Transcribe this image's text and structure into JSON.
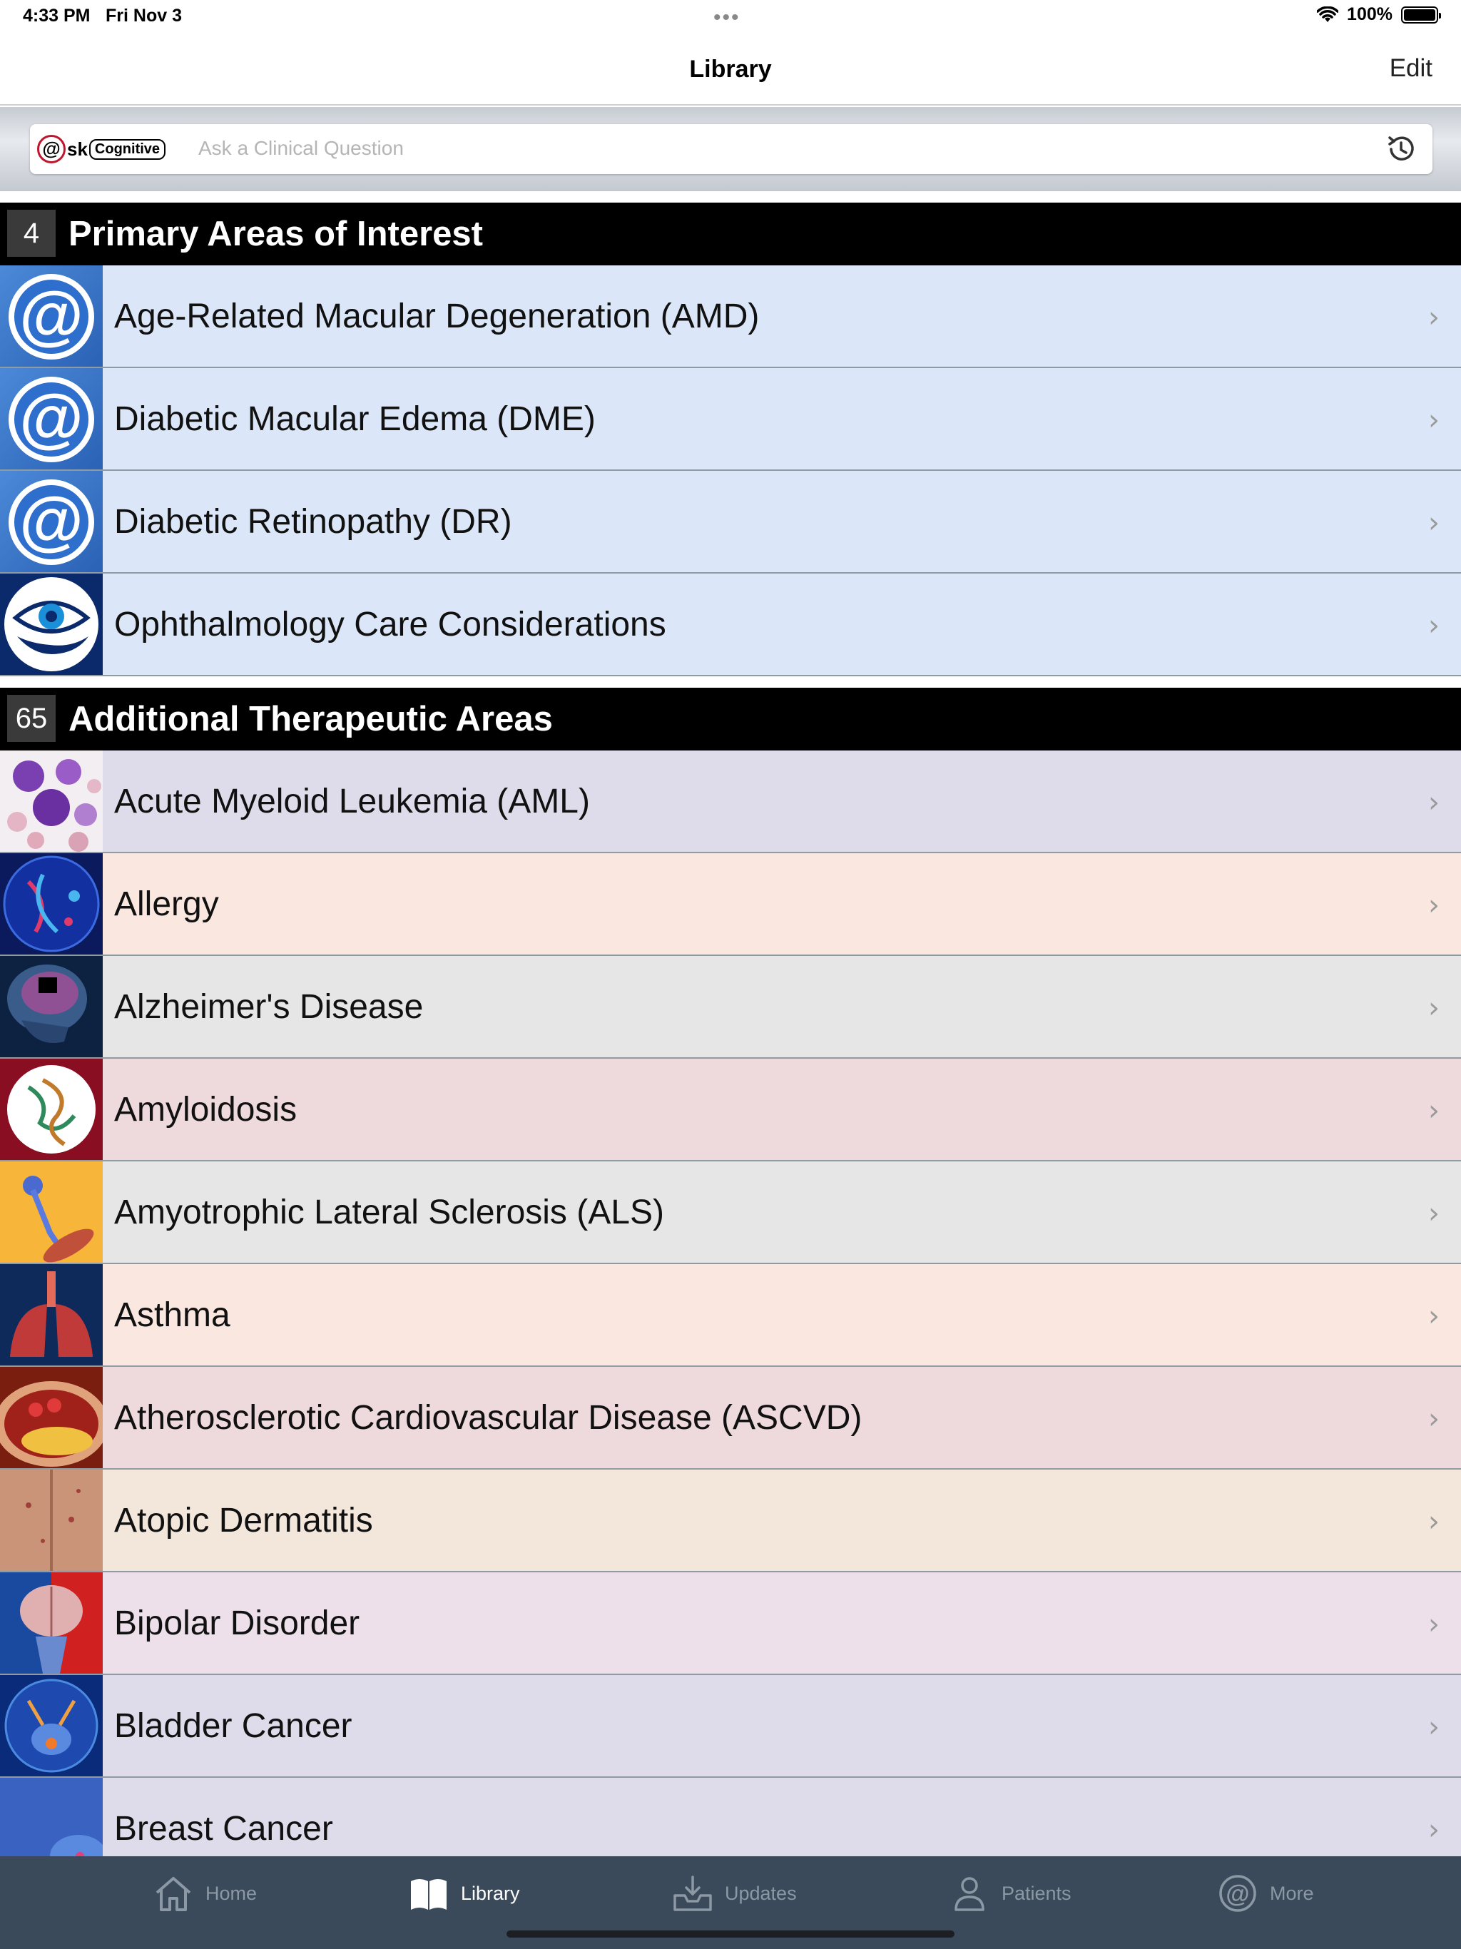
{
  "status_bar": {
    "time": "4:33 PM",
    "date": "Fri Nov 3",
    "battery": "100%"
  },
  "nav": {
    "title": "Library",
    "edit_label": "Edit"
  },
  "search": {
    "placeholder": "Ask a Clinical Question",
    "logo_at": "@",
    "logo_sk": "sk",
    "logo_cognitive": "Cognitive"
  },
  "sections": [
    {
      "count": "4",
      "title": "Primary Areas of Interest",
      "items": [
        {
          "label": "Age-Related Macular Degeneration (AMD)",
          "icon": "at-icon",
          "bg": "#dbe7f8"
        },
        {
          "label": "Diabetic Macular Edema (DME)",
          "icon": "at-icon",
          "bg": "#dbe7f8"
        },
        {
          "label": "Diabetic Retinopathy (DR)",
          "icon": "at-icon",
          "bg": "#dbe7f8"
        },
        {
          "label": "Ophthalmology Care Considerations",
          "icon": "eye-hand-icon",
          "bg": "#dbe7f8"
        }
      ]
    },
    {
      "count": "65",
      "title": "Additional Therapeutic Areas",
      "items": [
        {
          "label": "Acute Myeloid Leukemia (AML)",
          "icon": "blood-cells-icon",
          "bg": "#dedbea"
        },
        {
          "label": "Allergy",
          "icon": "allergy-icon",
          "bg": "#fae8e0"
        },
        {
          "label": "Alzheimer's Disease",
          "icon": "brain-skull-icon",
          "bg": "#e6e6e6"
        },
        {
          "label": "Amyloidosis",
          "icon": "protein-icon",
          "bg": "#eed9dc"
        },
        {
          "label": "Amyotrophic Lateral Sclerosis (ALS)",
          "icon": "neuron-icon",
          "bg": "#e6e6e6"
        },
        {
          "label": "Asthma",
          "icon": "lungs-icon",
          "bg": "#fae8e0"
        },
        {
          "label": "Atherosclerotic Cardiovascular Disease (ASCVD)",
          "icon": "artery-icon",
          "bg": "#eed9dc"
        },
        {
          "label": "Atopic Dermatitis",
          "icon": "skin-icon",
          "bg": "#f3e7dc"
        },
        {
          "label": "Bipolar Disorder",
          "icon": "brain-halves-icon",
          "bg": "#ede0ea"
        },
        {
          "label": "Bladder Cancer",
          "icon": "bladder-icon",
          "bg": "#dedbea"
        },
        {
          "label": "Breast Cancer",
          "icon": "breast-icon",
          "bg": "#dedbea"
        }
      ]
    }
  ],
  "tabs": [
    {
      "label": "Home",
      "icon": "home-icon",
      "active": false
    },
    {
      "label": "Library",
      "icon": "book-icon",
      "active": true
    },
    {
      "label": "Updates",
      "icon": "inbox-download-icon",
      "active": false
    },
    {
      "label": "Patients",
      "icon": "person-icon",
      "active": false
    },
    {
      "label": "More",
      "icon": "at-circle-icon",
      "active": false
    }
  ]
}
